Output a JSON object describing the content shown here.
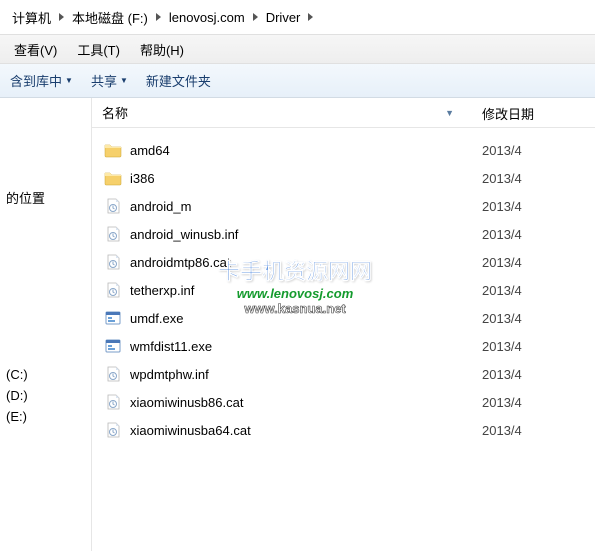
{
  "breadcrumb": [
    "计算机",
    "本地磁盘 (F:)",
    "lenovosj.com",
    "Driver"
  ],
  "menu": {
    "view": "查看(V)",
    "tools": "工具(T)",
    "help": "帮助(H)"
  },
  "toolbar": {
    "include": "含到库中",
    "share": "共享",
    "newfolder": "新建文件夹"
  },
  "columns": {
    "name": "名称",
    "date": "修改日期"
  },
  "sidebar": {
    "location_label": "的位置",
    "drives": [
      "(C:)",
      "(D:)",
      "(E:)"
    ]
  },
  "files": [
    {
      "icon": "folder",
      "name": "amd64",
      "date": "2013/4"
    },
    {
      "icon": "folder",
      "name": "i386",
      "date": "2013/4"
    },
    {
      "icon": "cat",
      "name": "android_m",
      "date": "2013/4"
    },
    {
      "icon": "inf",
      "name": "android_winusb.inf",
      "date": "2013/4"
    },
    {
      "icon": "cat",
      "name": "androidmtp86.cat",
      "date": "2013/4"
    },
    {
      "icon": "inf",
      "name": "tetherxp.inf",
      "date": "2013/4"
    },
    {
      "icon": "exe",
      "name": "umdf.exe",
      "date": "2013/4"
    },
    {
      "icon": "exe",
      "name": "wmfdist11.exe",
      "date": "2013/4"
    },
    {
      "icon": "inf",
      "name": "wpdmtphw.inf",
      "date": "2013/4"
    },
    {
      "icon": "cat",
      "name": "xiaomiwinusb86.cat",
      "date": "2013/4"
    },
    {
      "icon": "cat",
      "name": "xiaomiwinusba64.cat",
      "date": "2013/4"
    }
  ],
  "watermark": {
    "line1": "卡手机资源网网",
    "line2": "www.lenovosj.com",
    "line3": "www.kasnua.net"
  }
}
